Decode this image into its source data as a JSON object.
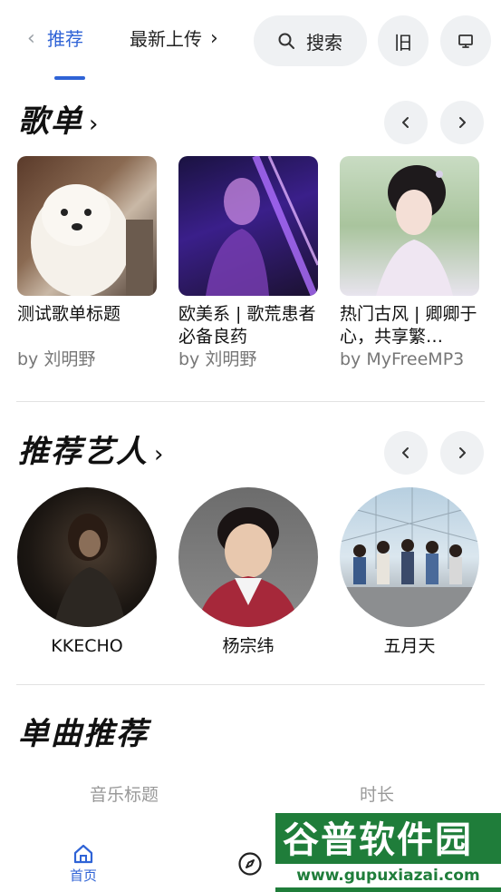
{
  "header": {
    "tab_prev_icon": "chevron-left-icon",
    "active_tab": "推荐",
    "next_tab": "最新上传",
    "tab_next_icon": "chevron-right-icon",
    "search_label": "搜索",
    "legacy_label": "旧",
    "screen_icon": "monitor-icon"
  },
  "playlists": {
    "title": "歌单",
    "items": [
      {
        "title": "测试歌单标题",
        "author": "by 刘明野"
      },
      {
        "title": "欧美系 | 歌荒患者必备良药",
        "author": "by 刘明野"
      },
      {
        "title": "热门古风 | 卿卿于心，共享繁…",
        "author": "by MyFreeMP3"
      }
    ]
  },
  "artists": {
    "title": "推荐艺人",
    "items": [
      {
        "name": "KKECHO"
      },
      {
        "name": "杨宗纬"
      },
      {
        "name": "五月天"
      }
    ]
  },
  "singles": {
    "title": "单曲推荐",
    "col_title": "音乐标题",
    "col_duration": "时长"
  },
  "bottom_nav": {
    "home_label": "首页"
  },
  "watermark": {
    "text": "谷普软件园",
    "url": "www.gupuxiazai.com"
  },
  "colors": {
    "accent": "#2f63d6",
    "pill_bg": "#eff1f3"
  }
}
